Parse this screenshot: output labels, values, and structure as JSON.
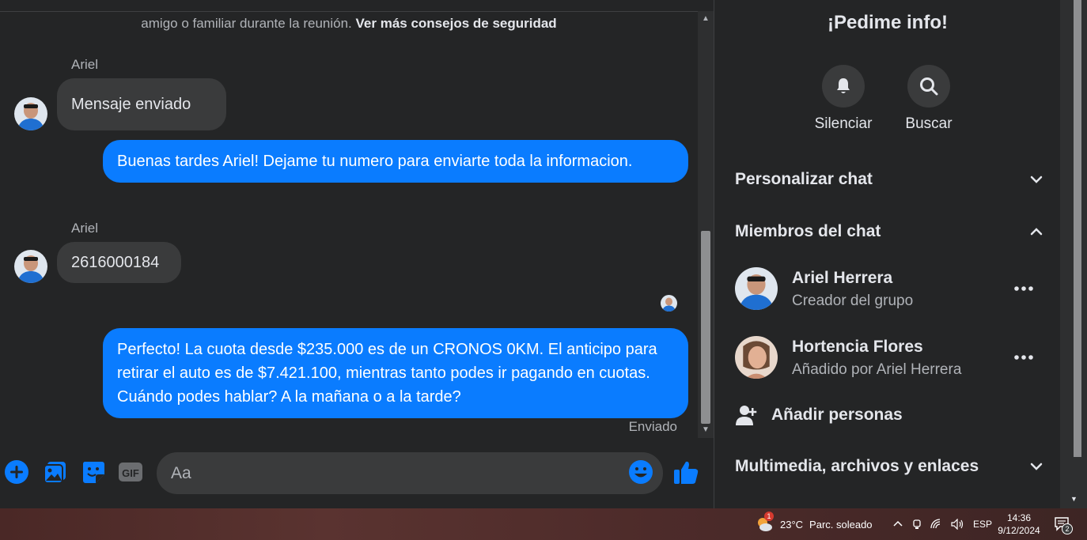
{
  "chat": {
    "notice_text": "amigo o familiar durante la reunión.",
    "notice_link": "Ver más consejos de seguridad",
    "messages": [
      {
        "sender": "Ariel",
        "text": "Mensaje enviado"
      },
      {
        "text": "Buenas tardes Ariel! Dejame tu numero para enviarte toda la informacion."
      },
      {
        "sender": "Ariel",
        "text": "2616000184"
      },
      {
        "text": "Perfecto! La cuota desde $235.000 es de un CRONOS 0KM. El anticipo para retirar el auto es de $7.421.100, mientras tanto podes ir pagando en cuotas. Cuándo podes hablar? A la mañana o a la tarde?"
      }
    ],
    "status": "Enviado"
  },
  "composer": {
    "placeholder": "Aa",
    "icons": [
      "plus-circle-icon",
      "image-icon",
      "sticker-icon",
      "gif-icon",
      "smiley-icon",
      "thumbs-up-icon"
    ],
    "gif_label": "GIF"
  },
  "panel": {
    "title": "¡Pedime info!",
    "actions": [
      {
        "label": "Silenciar",
        "icon": "bell-icon"
      },
      {
        "label": "Buscar",
        "icon": "search-icon"
      }
    ],
    "sections": {
      "customize": "Personalizar chat",
      "members": "Miembros del chat",
      "media": "Multimedia, archivos y enlaces"
    },
    "members": [
      {
        "name": "Ariel Herrera",
        "subtitle": "Creador del grupo"
      },
      {
        "name": "Hortencia Flores",
        "subtitle": "Añadido por Ariel Herrera"
      }
    ],
    "add_people": "Añadir personas"
  },
  "taskbar": {
    "weather": "23°C",
    "weather_desc": "Parc. soleado",
    "weather_badge": "1",
    "language": "ESP",
    "time": "14:36",
    "date": "9/12/2024",
    "notifications": "2"
  },
  "colors": {
    "outgoing_bubble": "#0a7cff",
    "incoming_bubble": "#3a3b3c",
    "background": "#242526",
    "accent": "#0a7cff"
  }
}
